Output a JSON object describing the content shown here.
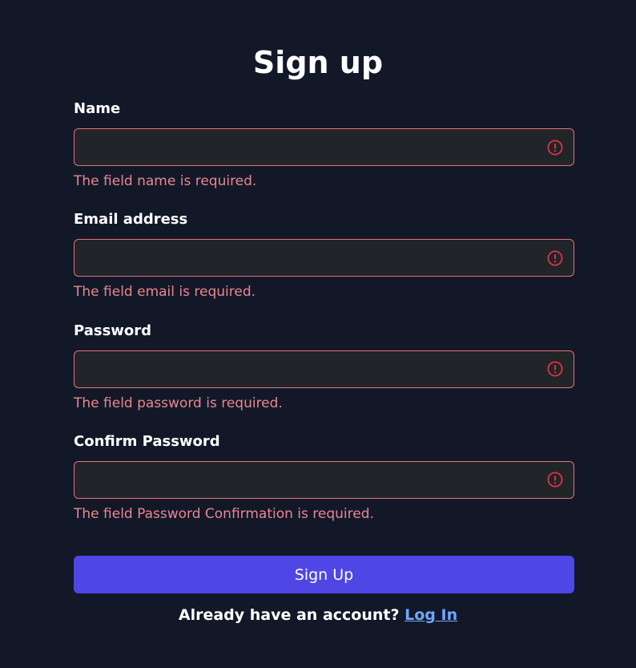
{
  "title": "Sign up",
  "form": {
    "name": {
      "label": "Name",
      "value": "",
      "error": "The field name is required."
    },
    "email": {
      "label": "Email address",
      "value": "",
      "error": "The field email is required."
    },
    "password": {
      "label": "Password",
      "value": "",
      "error": "The field password is required."
    },
    "confirm_password": {
      "label": "Confirm Password",
      "value": "",
      "error": "The field Password Confirmation is required."
    },
    "submit_label": "Sign Up"
  },
  "footer": {
    "prompt": "Already have an account?",
    "link_label": "Log In"
  },
  "icons": {
    "field_error": "exclamation-circle-icon"
  },
  "colors": {
    "background": "#121828",
    "input_background": "#212429",
    "error_border": "#e5717a",
    "error_text": "#ea868f",
    "error_icon": "#dc3545",
    "primary_button": "#4f46e5",
    "link": "#6ea8fe"
  }
}
